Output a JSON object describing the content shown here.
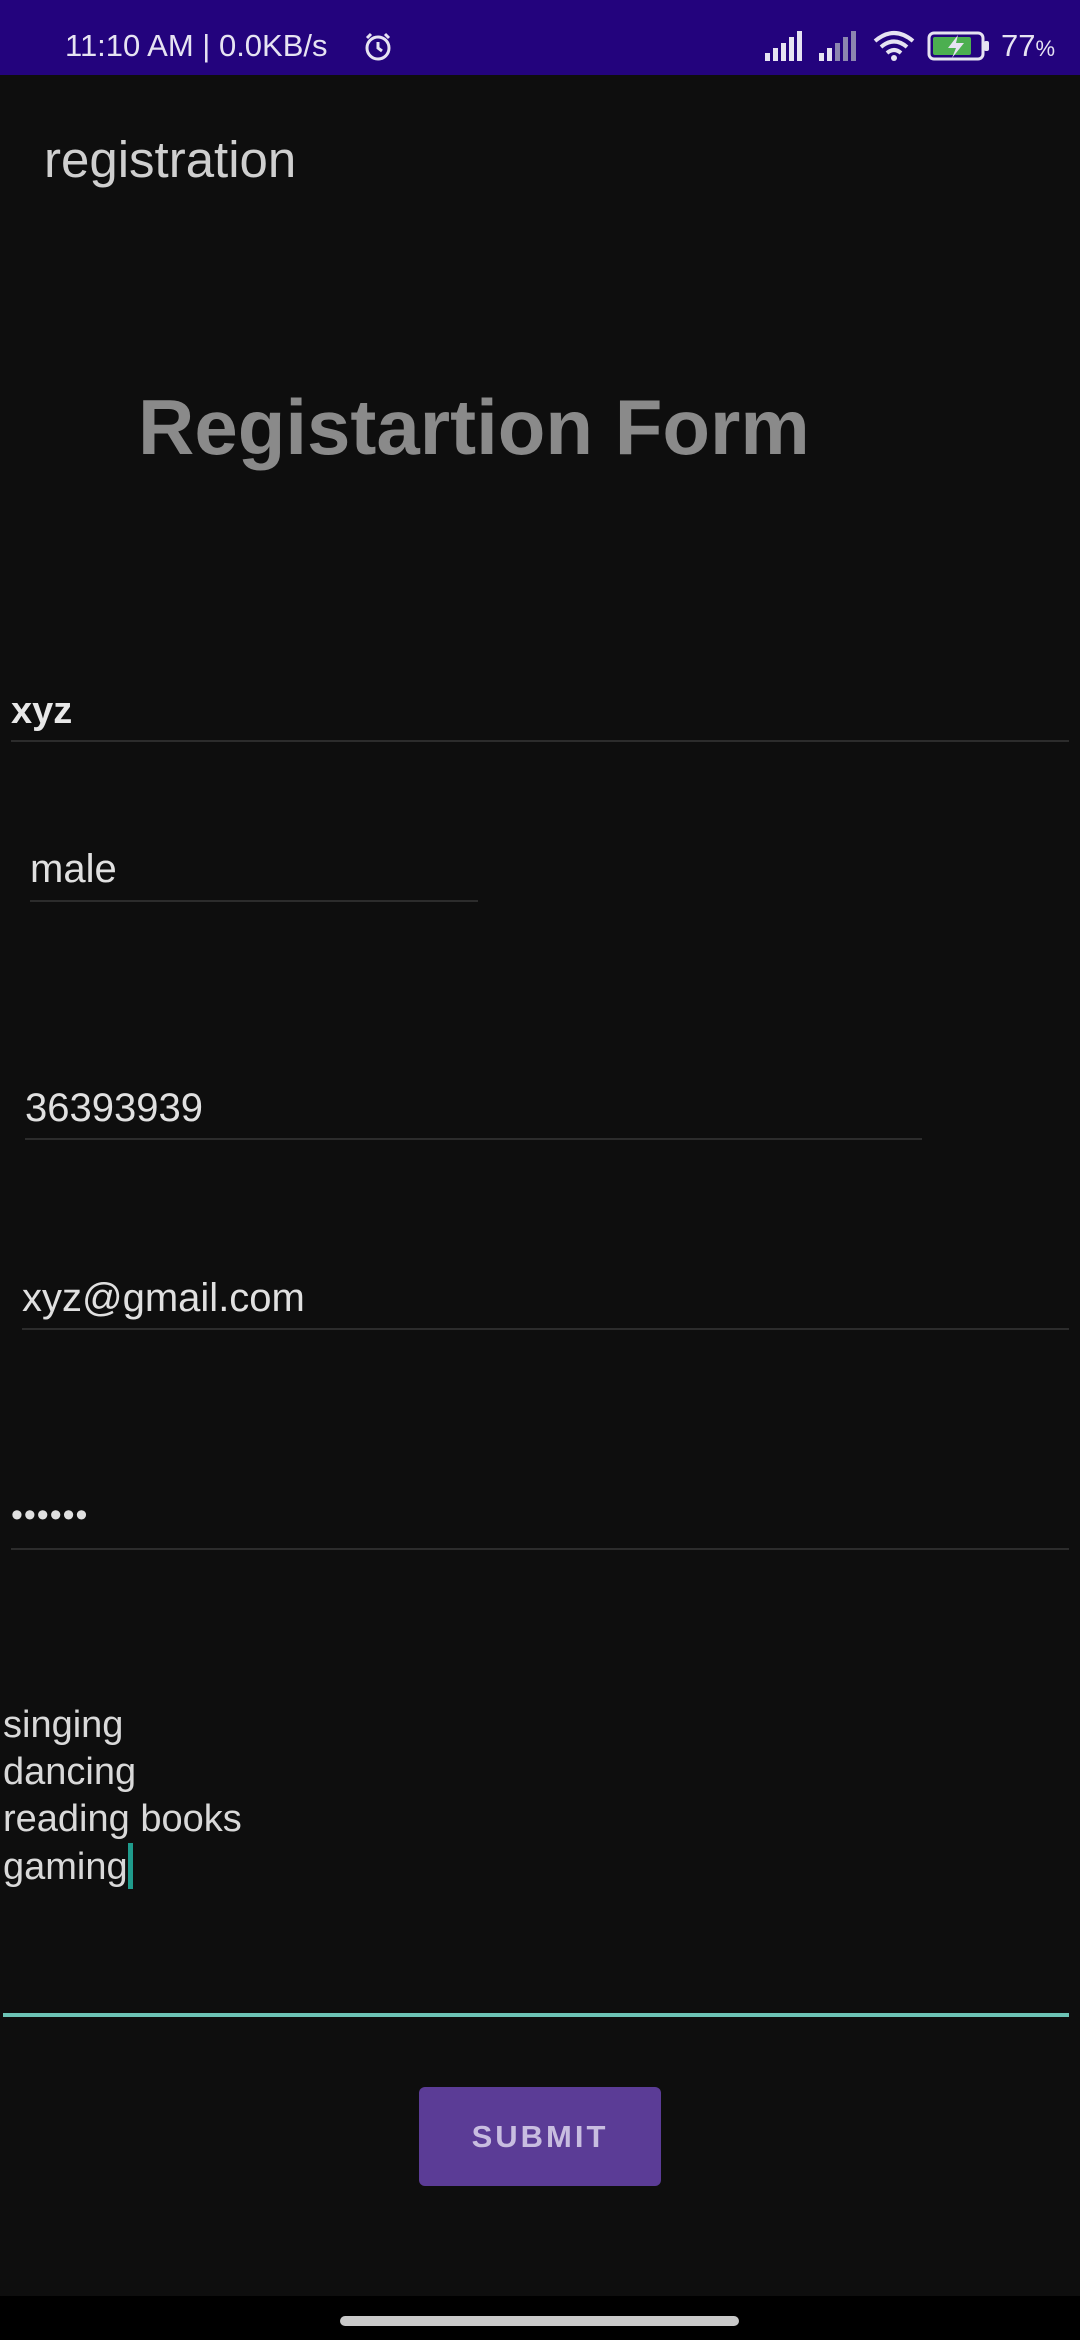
{
  "status_bar": {
    "time": "11:10 AM | 0.0KB/s",
    "battery_percent": "77",
    "battery_unit": "%",
    "icons": [
      "alarm-icon",
      "signal-icon",
      "signal-icon",
      "wifi-icon",
      "battery-charging-icon"
    ]
  },
  "app_bar": {
    "title": "registration"
  },
  "form": {
    "heading": "Registartion Form",
    "name_value": "xyz",
    "gender_value": "male",
    "phone_value": "36393939",
    "email_value": "xyz@gmail.com",
    "password_value": "••••••",
    "hobbies_value": "singing\ndancing\nreading books\ngaming",
    "submit_label": "SUBMIT"
  },
  "colors": {
    "status_bar": "#23037d",
    "background": "#0e0e0e",
    "accent": "#6cc3b5",
    "button": "#5b3c96"
  }
}
